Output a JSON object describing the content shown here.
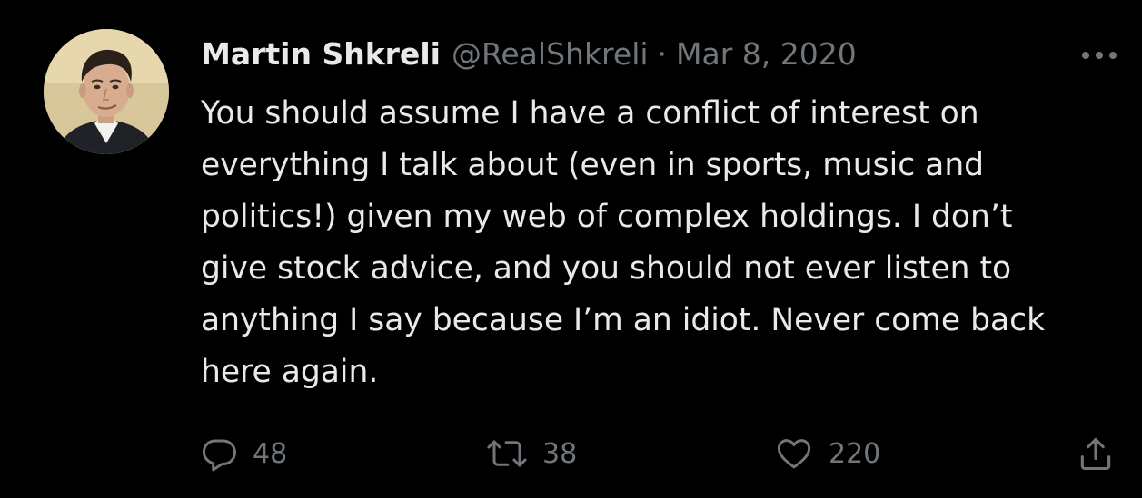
{
  "tweet": {
    "author_name": "Martin Shkreli",
    "handle": "@RealShkreli",
    "separator": "·",
    "date": "Mar 8, 2020",
    "lines": [
      "You should assume I have a conflict of interest on",
      "everything I talk about (even in sports, music and",
      "politics!) given my web of complex holdings. I don’t",
      "give stock advice, and you should not ever listen to",
      "anything I say because I’m an idiot. Never come back",
      "here again."
    ],
    "actions": {
      "replies": "48",
      "retweets": "38",
      "likes": "220"
    }
  },
  "icons": {
    "more": "more-horizontal-icon",
    "reply": "reply-bubble-icon",
    "retweet": "retweet-arrows-icon",
    "like": "heart-icon",
    "share": "share-upload-icon"
  },
  "colors": {
    "background": "#000000",
    "primary_text": "#e7e9ea",
    "secondary_text": "#71767b"
  }
}
